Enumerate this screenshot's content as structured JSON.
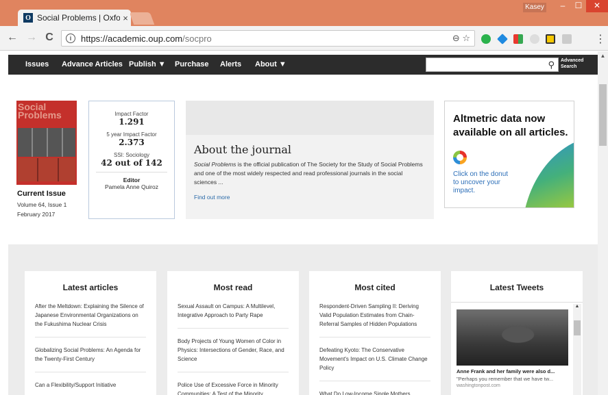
{
  "browser": {
    "tab_title": "Social Problems | Oxford",
    "tab_close": "×",
    "favicon": "O",
    "user": "Kasey",
    "window_min": "–",
    "window_max": "☐",
    "window_close": "✕",
    "url_host": "https://academic.oup.com",
    "url_path": "/socpro",
    "back": "←",
    "forward": "→",
    "reload": "C",
    "zoom_icon": "⊖",
    "star_icon": "☆",
    "menu": "⋮"
  },
  "sitenav": {
    "items": [
      "Issues",
      "Advance Articles",
      "Publish ▼",
      "Purchase",
      "Alerts",
      "About ▼"
    ],
    "search_icon": "⚲",
    "advanced_line1": "Advanced",
    "advanced_line2": "Search"
  },
  "journal": {
    "cover_title": "Social Problems",
    "current_issue_label": "Current Issue",
    "volume": "Volume 64, Issue 1",
    "date": "February 2017"
  },
  "metrics": {
    "impact_label": "Impact Factor",
    "impact_value": "1.291",
    "five_year_label": "5 year Impact Factor",
    "five_year_value": "2.373",
    "ssi_label": "SSI: Sociology",
    "ssi_value": "42 out of 142",
    "editor_label": "Editor",
    "editor_name": "Pamela Anne Quiroz"
  },
  "about": {
    "title": "About the journal",
    "desc_italic": "Social Problems",
    "desc_rest": " is the official publication of The Society for the Study of Social Problems and one of the most widely respected and read professional journals in the social sciences ...",
    "link": "Find out more"
  },
  "altmetric": {
    "title": "Altmetric data now available on all articles.",
    "cta": "Click on the donut to uncover your impact."
  },
  "latest_articles": {
    "heading": "Latest articles",
    "items": [
      "After the Meltdown: Explaining the Silence of Japanese Environmental Organizations on the Fukushima Nuclear Crisis",
      "Globalizing Social Problems: An Agenda for the Twenty-First Century",
      "Can a Flexibility/Support Initiative"
    ]
  },
  "most_read": {
    "heading": "Most read",
    "items": [
      "Sexual Assault on Campus: A Multilevel, Integrative Approach to Party Rape",
      "Body Projects of Young Women of Color in Physics: Intersections of Gender, Race, and Science",
      "Police Use of Excessive Force in Minority Communities: A Test of the Minority"
    ]
  },
  "most_cited": {
    "heading": "Most cited",
    "items": [
      "Respondent-Driven Sampling II: Deriving Valid Population Estimates from Chain-Referral Samples of Hidden Populations",
      "Defeating Kyoto: The Conservative Movement's Impact on U.S. Climate Change Policy",
      "What Do Low-Income Single Mothers"
    ]
  },
  "tweets": {
    "heading": "Latest Tweets",
    "headline": "Anne Frank and her family were also d...",
    "quote": "\"Perhaps you remember that we have tw...",
    "source": "washingtonpost.com"
  }
}
